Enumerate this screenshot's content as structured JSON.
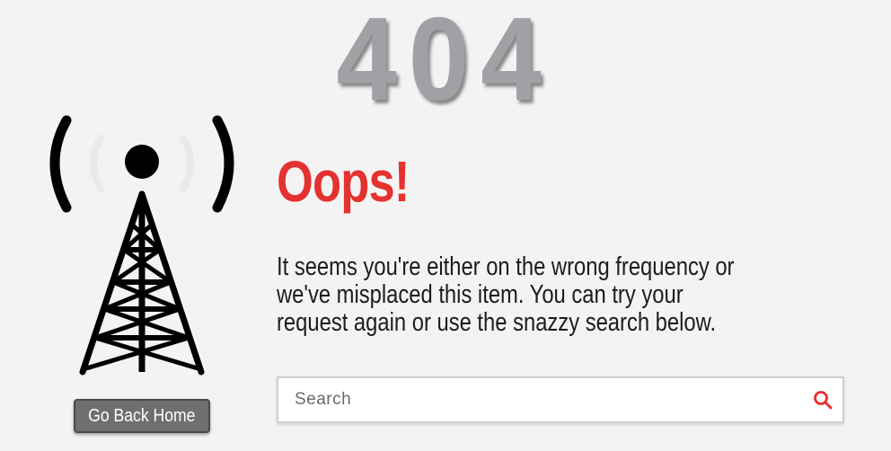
{
  "error_code": "404",
  "heading": "Oops!",
  "message": "It seems you're either on the wrong frequency or\nwe've misplaced this item. You can try your\nrequest again or use the snazzy search below.",
  "search": {
    "placeholder": "Search",
    "value": "",
    "icon": "search-icon"
  },
  "home_button": {
    "label": "Go Back Home"
  },
  "illustration": {
    "icon": "radio-tower-icon"
  },
  "colors": {
    "background": "#f3f3f3",
    "error_code": "#a0a1a4",
    "heading": "#e5312f",
    "body_text": "#1c1c1c",
    "search_icon": "#e5312f",
    "button_bg": "#6f6f6f",
    "button_text": "#ffffff",
    "tower": "#000000"
  }
}
